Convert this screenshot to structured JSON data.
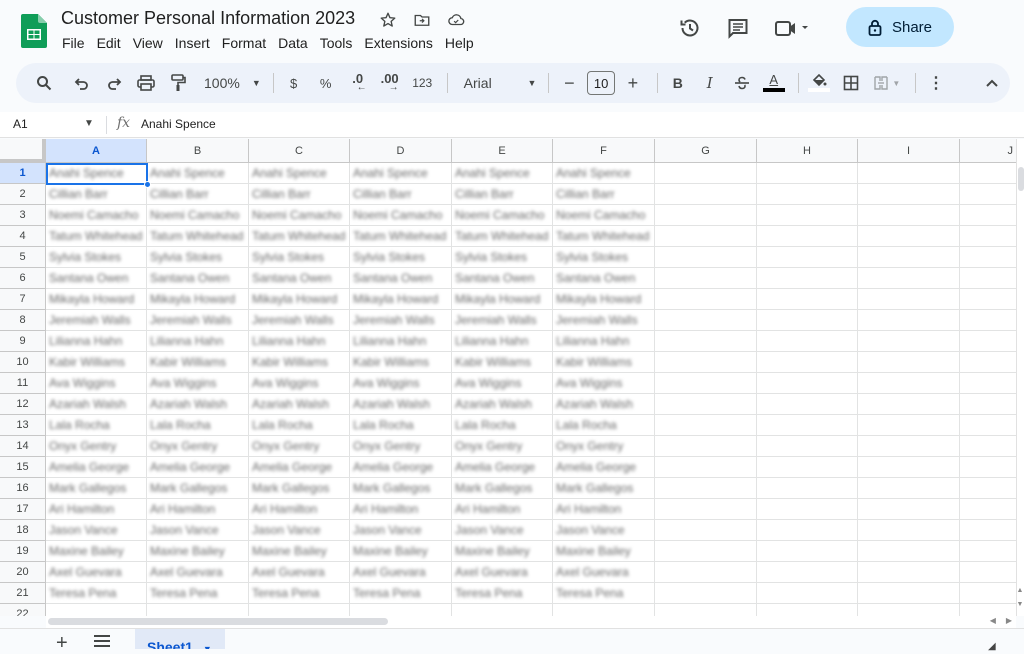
{
  "app": {
    "title": "Customer Personal Information 2023",
    "menu": [
      "File",
      "Edit",
      "View",
      "Insert",
      "Format",
      "Data",
      "Tools",
      "Extensions",
      "Help"
    ],
    "share_label": "Share",
    "title_icons": [
      "star-icon",
      "move-to-folder-icon",
      "cloud-saved-icon"
    ],
    "right_icons": [
      "version-history-icon",
      "comments-icon",
      "meet-video-icon"
    ]
  },
  "toolbar": {
    "zoom": "100%",
    "currency": "$",
    "percent": "%",
    "decrease_decimal": ".0",
    "increase_decimal": ".00",
    "number_format": "123",
    "font": "Arial",
    "font_size": "10",
    "bold": "B",
    "italic": "I",
    "text_color_letter": "A"
  },
  "formula_bar": {
    "cell_ref": "A1",
    "fx": "fx",
    "value": "Anahi Spence"
  },
  "grid": {
    "columns": [
      "A",
      "B",
      "C",
      "D",
      "E",
      "F",
      "G",
      "H",
      "I",
      "J"
    ],
    "selected_cell": "A1",
    "rows": [
      "Anahi Spence",
      "Cillian Barr",
      "Noemi Camacho",
      "Tatum Whitehead",
      "Sylvia Stokes",
      "Santana Owen",
      "Mikayla Howard",
      "Jeremiah Walls",
      "Lilianna Hahn",
      "Kabir Williams",
      "Ava Wiggins",
      "Azariah Walsh",
      "Lala Rocha",
      "Onyx Gentry",
      "Amelia George",
      "Mark Gallegos",
      "Ari Hamilton",
      "Jason Vance",
      "Maxine Bailey",
      "Axel Guevara",
      "Teresa Pena",
      ""
    ],
    "filled_columns": 6
  },
  "sheets": {
    "tabs": [
      {
        "label": "Sheet1",
        "active": true
      }
    ]
  }
}
